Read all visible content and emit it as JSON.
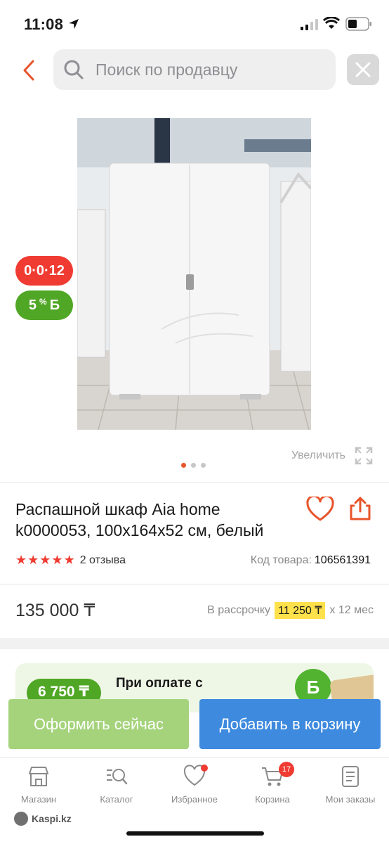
{
  "status_bar": {
    "time": "11:08"
  },
  "search": {
    "placeholder": "Поиск по продавцу"
  },
  "product": {
    "installment_badge": "0·0·12",
    "bonus_badge": {
      "percent": "5",
      "unit": "%",
      "symbol": "Б"
    },
    "zoom_label": "Увеличить",
    "gallery": {
      "total": 3,
      "active": 0
    },
    "title": "Распашной шкаф Aia home k0000053, 100x164x52 см, белый",
    "rating": {
      "stars": 5,
      "reviews_label": "2 отзыва"
    },
    "code_label": "Код товара:",
    "code_value": "106561391",
    "price": "135 000 ₸",
    "installment": {
      "prefix": "В рассрочку",
      "amount": "11 250 ₸",
      "suffix": "x 12 мес"
    }
  },
  "promo": {
    "amount": "6 750 ₸",
    "text": "При оплате с",
    "coin": "Б"
  },
  "actions": {
    "buy_now": "Оформить сейчас",
    "add_to_cart": "Добавить в корзину"
  },
  "tabbar": {
    "items": [
      {
        "label": "Магазин",
        "icon": "shop-icon"
      },
      {
        "label": "Каталог",
        "icon": "catalog-search-icon"
      },
      {
        "label": "Избранное",
        "icon": "heart-icon"
      },
      {
        "label": "Корзина",
        "icon": "cart-icon",
        "badge": "17"
      },
      {
        "label": "Мои заказы",
        "icon": "orders-icon"
      }
    ]
  },
  "brand": "Kaspi.kz",
  "colors": {
    "accent_red": "#ef3b32",
    "bonus_green": "#50a625",
    "cart_blue": "#3d8ade",
    "buy_green": "#a5d37c"
  }
}
